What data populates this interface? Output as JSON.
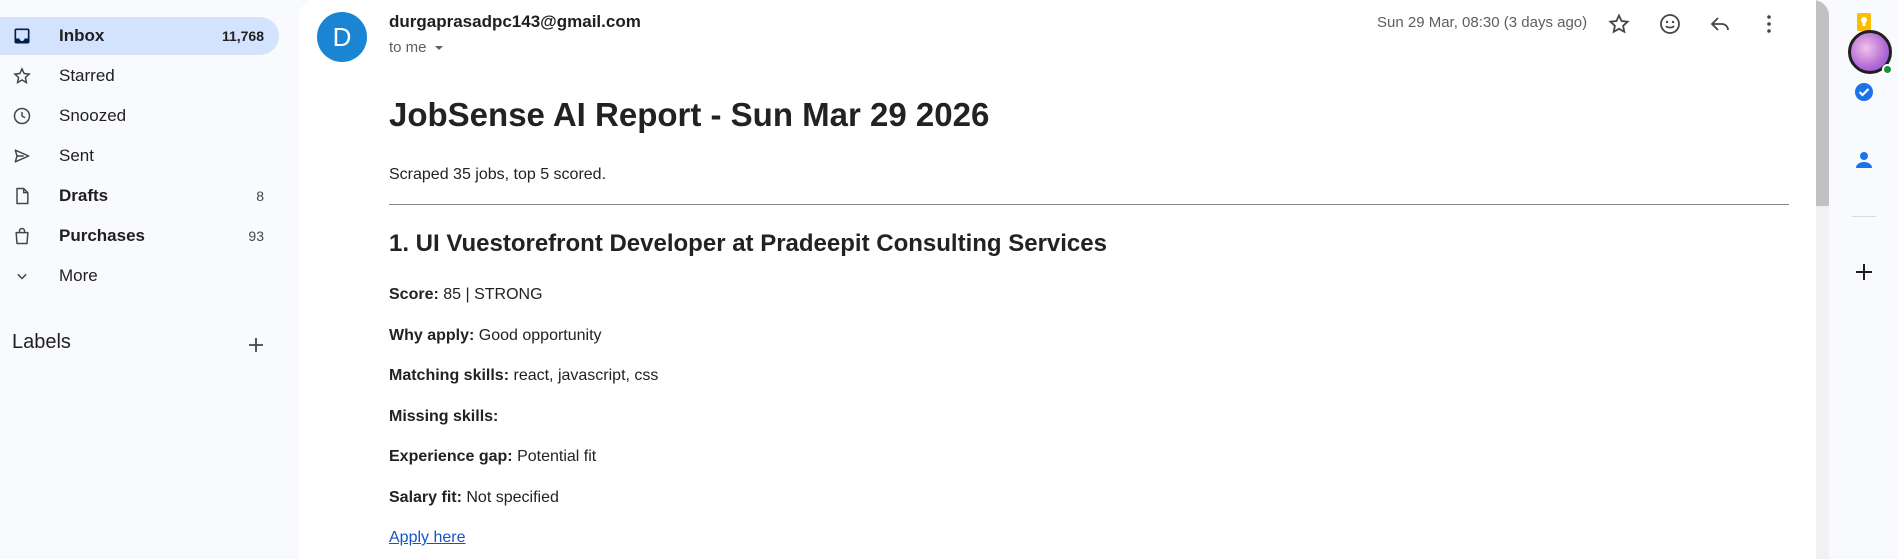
{
  "sidebar": {
    "items": [
      {
        "label": "Inbox",
        "count": "11,768",
        "icon": "inbox-icon"
      },
      {
        "label": "Starred",
        "count": "",
        "icon": "star-icon"
      },
      {
        "label": "Snoozed",
        "count": "",
        "icon": "clock-icon"
      },
      {
        "label": "Sent",
        "count": "",
        "icon": "send-icon"
      },
      {
        "label": "Drafts",
        "count": "8",
        "icon": "draft-icon"
      },
      {
        "label": "Purchases",
        "count": "93",
        "icon": "shopping-bag-icon"
      },
      {
        "label": "More",
        "count": "",
        "icon": "chevron-down-icon"
      }
    ],
    "labels_title": "Labels"
  },
  "email": {
    "avatar_letter": "D",
    "sender": "durgaprasadpc143@gmail.com",
    "recipient": "to me",
    "date": "Sun 29 Mar, 08:30 (3 days ago)",
    "title": "JobSense AI Report - Sun Mar 29 2026",
    "summary": "Scraped 35 jobs, top 5 scored.",
    "job": {
      "title": "1. UI Vuestorefront Developer at Pradeepit Consulting Services",
      "score_label": "Score:",
      "score_value": "85 | STRONG",
      "why_label": "Why apply:",
      "why_value": "Good opportunity",
      "matching_label": "Matching skills:",
      "matching_value": "react, javascript, css",
      "missing_label": "Missing skills:",
      "missing_value": "",
      "gap_label": "Experience gap:",
      "gap_value": "Potential fit",
      "salary_label": "Salary fit:",
      "salary_value": "Not specified",
      "apply_text": "Apply here"
    }
  },
  "colors": {
    "accent_active": "#d3e3fd",
    "avatar_bg": "#1a85d3",
    "link": "#1155cc"
  }
}
